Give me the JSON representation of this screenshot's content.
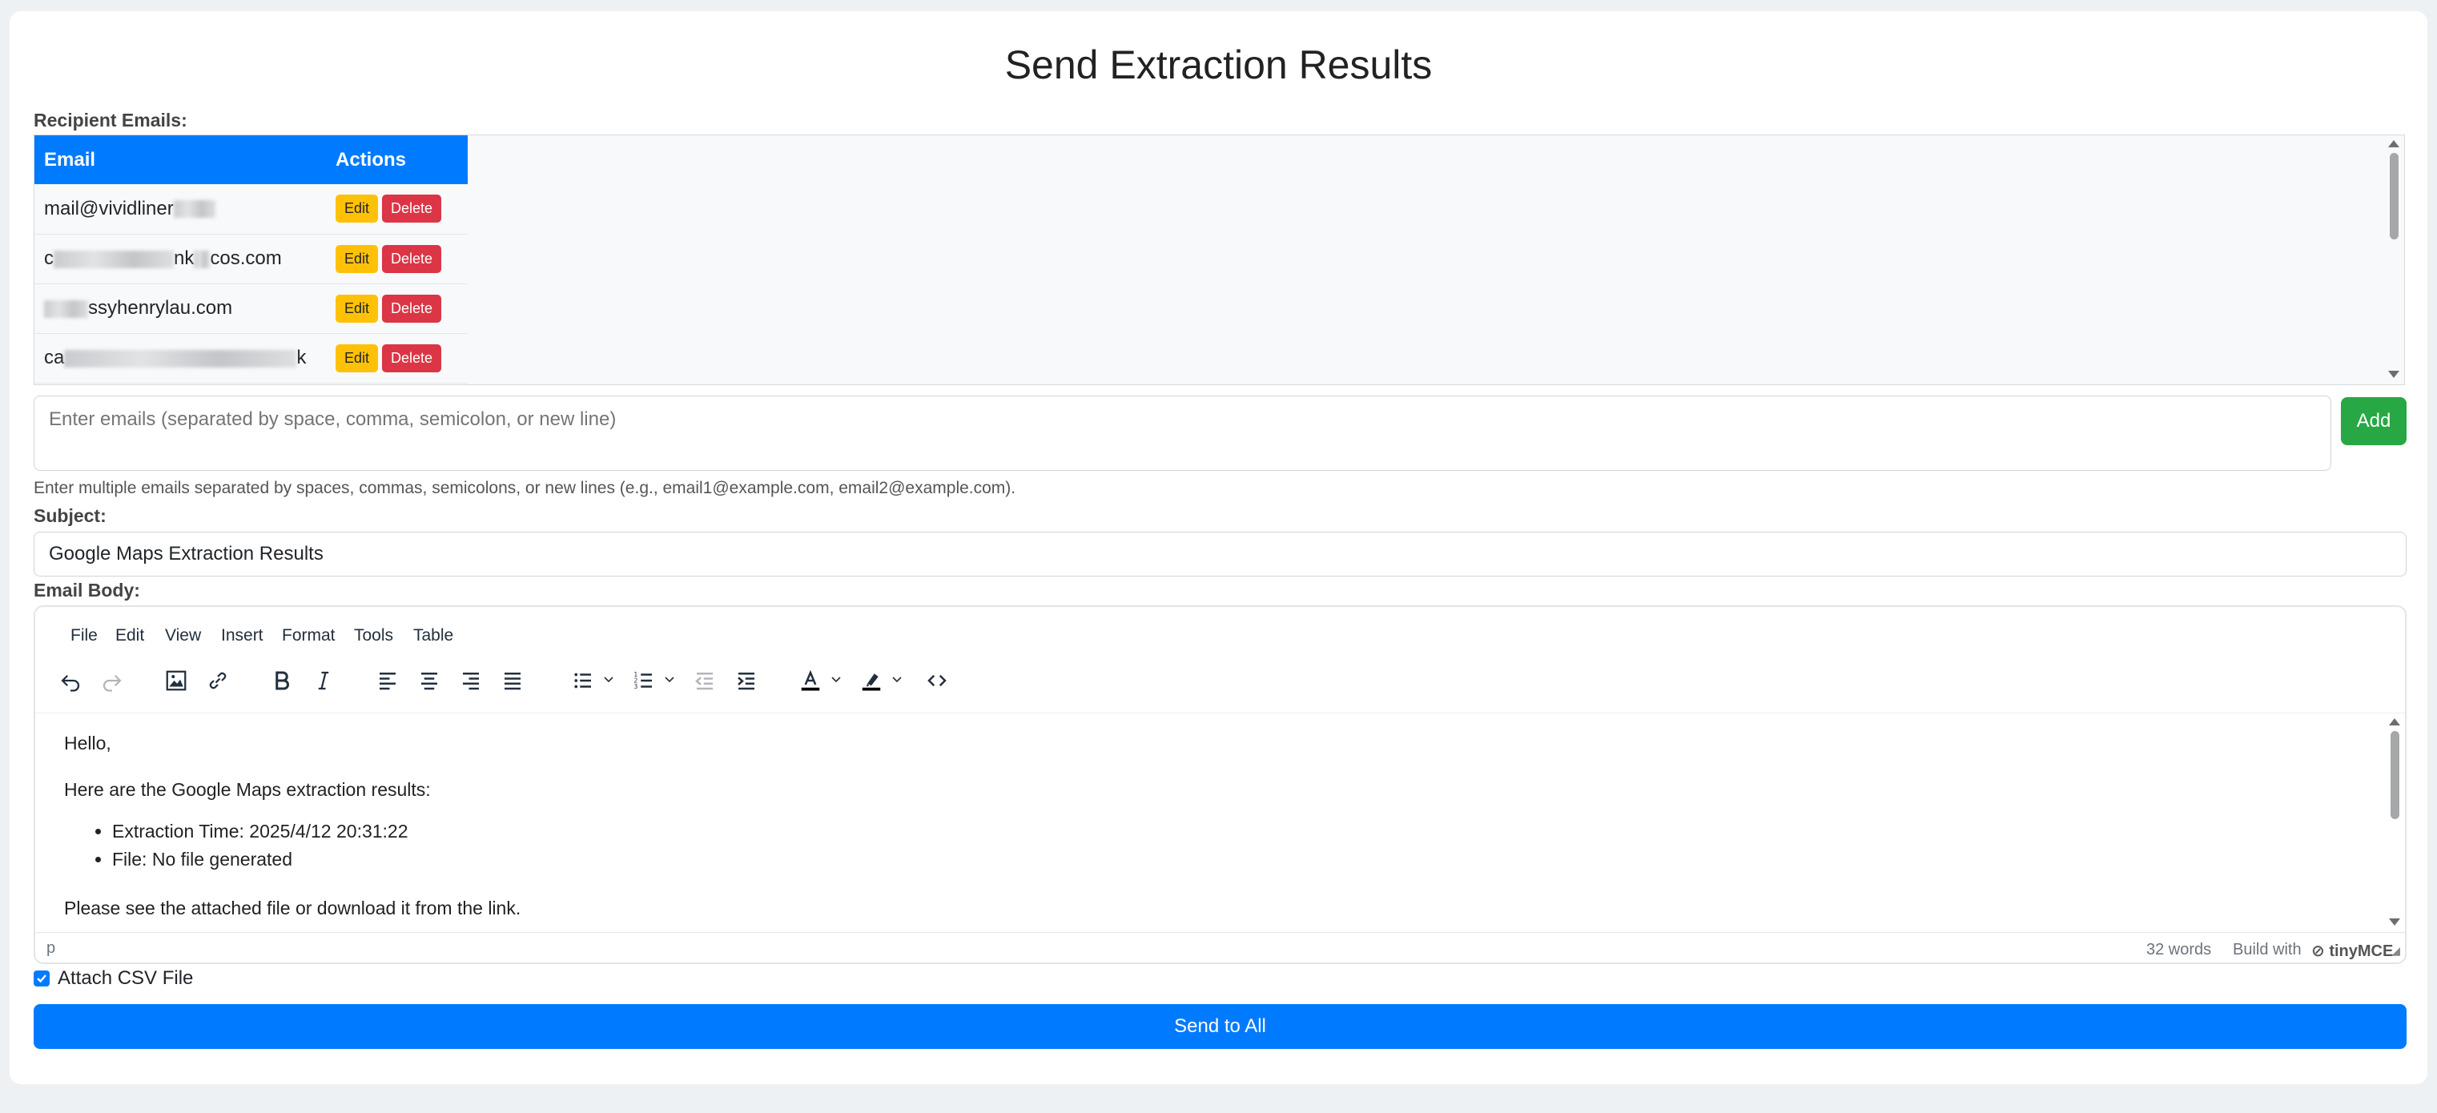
{
  "page": {
    "title": "Send Extraction Results"
  },
  "recipients": {
    "label": "Recipient Emails:",
    "columns": [
      "Email",
      "Actions"
    ],
    "rows": [
      {
        "email": "mail@vividliner",
        "edit": "Edit",
        "delete": "Delete"
      },
      {
        "email": "c",
        "email_tail": "nk",
        "email_end": "cos.com",
        "edit": "Edit",
        "delete": "Delete"
      },
      {
        "email": "",
        "email_tail": "ssyhenrylau.com",
        "edit": "Edit",
        "delete": "Delete"
      },
      {
        "email": "ca",
        "email_tail": "k",
        "edit": "Edit",
        "delete": "Delete"
      }
    ]
  },
  "add_emails": {
    "placeholder": "Enter emails (separated by space, comma, semicolon, or new line)",
    "button": "Add",
    "hint": "Enter multiple emails separated by spaces, commas, semicolons, or new lines (e.g., email1@example.com, email2@example.com)."
  },
  "subject": {
    "label": "Subject:",
    "value": "Google Maps Extraction Results"
  },
  "body": {
    "label": "Email Body:",
    "menu": [
      "File",
      "Edit",
      "View",
      "Insert",
      "Format",
      "Tools",
      "Table"
    ],
    "toolbar_icons": [
      "undo-icon",
      "redo-icon",
      "image-icon",
      "link-icon",
      "bold-icon",
      "italic-icon",
      "align-left-icon",
      "align-center-icon",
      "align-right-icon",
      "justify-icon",
      "bullet-list-icon",
      "numbered-list-icon",
      "outdent-icon",
      "indent-icon",
      "text-color-icon",
      "highlight-icon",
      "source-code-icon"
    ],
    "greeting": "Hello,",
    "intro": "Here are the Google Maps extraction results:",
    "items": [
      "Extraction Time: 2025/4/12 20:31:22",
      "File: No file generated"
    ],
    "closing": "Please see the attached file or download it from the link.",
    "status_path": "p",
    "word_count": "32 words",
    "build_with": "Build with",
    "brand": "tinyMCE"
  },
  "attach": {
    "label": "Attach CSV File",
    "checked": true
  },
  "send_button": "Send to All",
  "colors": {
    "primary": "#007bff",
    "success": "#28a745",
    "warning": "#ffc107",
    "danger": "#dc3545"
  }
}
